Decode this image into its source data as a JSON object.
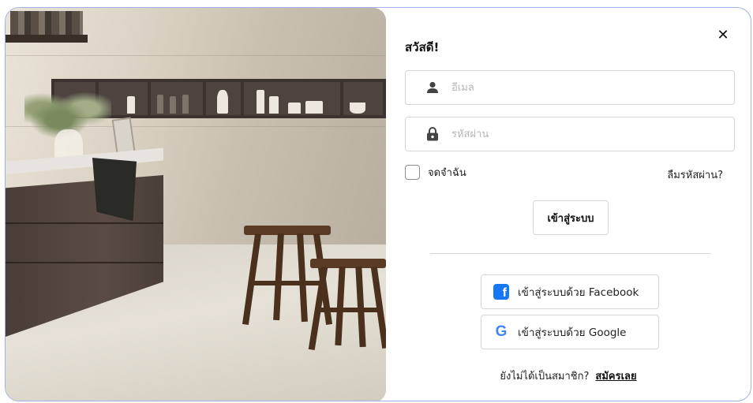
{
  "login": {
    "greeting": "สวัสดี!",
    "email": {
      "value": "",
      "placeholder": "อีเมล",
      "icon": "user-icon"
    },
    "password": {
      "value": "",
      "placeholder": "รหัสผ่าน",
      "icon": "lock-icon"
    },
    "remember": {
      "label": "จดจำฉัน",
      "checked": false
    },
    "forgot_label": "ลืมรหัสผ่าน?",
    "submit_label": "เข้าสู่ระบบ",
    "facebook_label": "เข้าสู่ระบบด้วย Facebook",
    "google_label": "เข้าสู่ระบบด้วย Google",
    "signup_question": "ยังไม่ได้เป็นสมาชิก?",
    "signup_link": "สมัครเลย",
    "close_icon": "close-icon"
  },
  "colors": {
    "border": "#9db4ea",
    "facebook": "#1877f2",
    "google_blue": "#4285f4"
  }
}
